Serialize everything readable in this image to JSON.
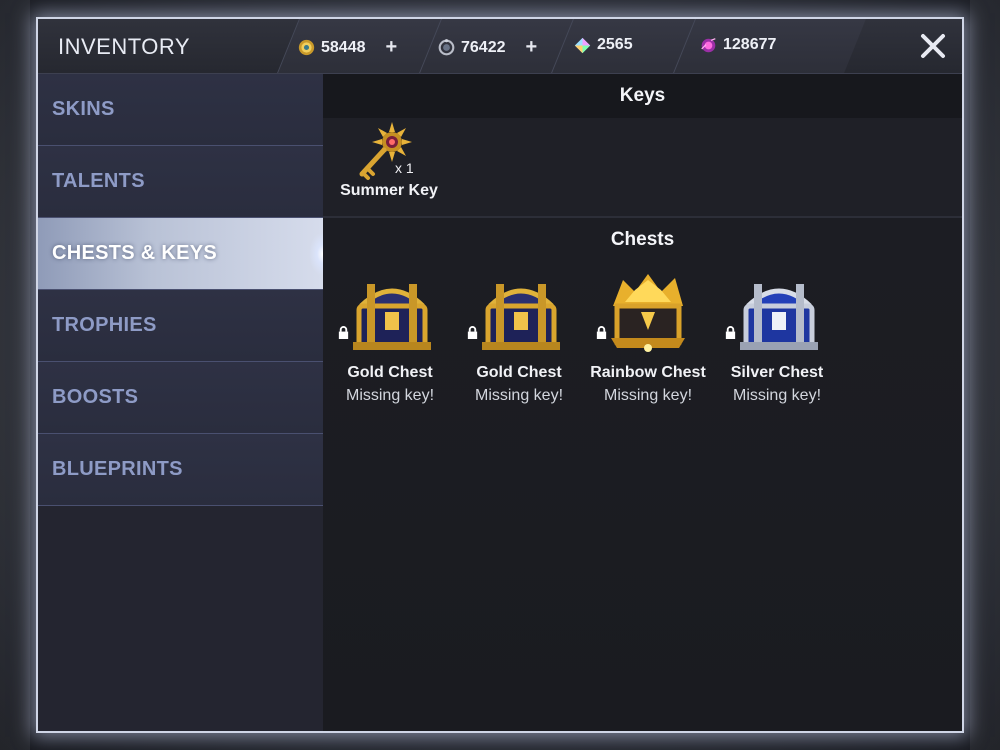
{
  "window": {
    "title": "INVENTORY",
    "close_icon": "close-icon"
  },
  "currencies": [
    {
      "id": "gold",
      "icon": "gold-coin-icon",
      "value": "58448",
      "plus": "+",
      "color": "#e0b13a"
    },
    {
      "id": "glory",
      "icon": "glory-icon",
      "value": "76422",
      "plus": "+",
      "color": "#b9bdc8"
    },
    {
      "id": "ice",
      "icon": "ice-crystal-icon",
      "value": "2565",
      "color": "#c884ff"
    },
    {
      "id": "essence",
      "icon": "essence-icon",
      "value": "128677",
      "color": "#e040c8"
    }
  ],
  "sidebar": {
    "items": [
      {
        "label": "SKINS",
        "active": false
      },
      {
        "label": "TALENTS",
        "active": false
      },
      {
        "label": "CHESTS & KEYS",
        "active": true
      },
      {
        "label": "TROPHIES",
        "active": false
      },
      {
        "label": "BOOSTS",
        "active": false
      },
      {
        "label": "BLUEPRINTS",
        "active": false
      }
    ]
  },
  "keys": {
    "header": "Keys",
    "items": [
      {
        "name": "Summer Key",
        "count": "x 1",
        "icon": "summer-key-icon"
      }
    ]
  },
  "chests": {
    "header": "Chests",
    "items": [
      {
        "name": "Gold Chest",
        "status": "Missing key!",
        "icon": "gold-chest-icon",
        "lock_icon": "lock-icon"
      },
      {
        "name": "Gold Chest",
        "status": "Missing key!",
        "icon": "gold-chest-icon",
        "lock_icon": "lock-icon"
      },
      {
        "name": "Rainbow Chest",
        "status": "Missing key!",
        "icon": "rainbow-chest-icon",
        "lock_icon": "lock-icon"
      },
      {
        "name": "Silver Chest",
        "status": "Missing key!",
        "icon": "silver-chest-icon",
        "lock_icon": "lock-icon"
      }
    ]
  }
}
